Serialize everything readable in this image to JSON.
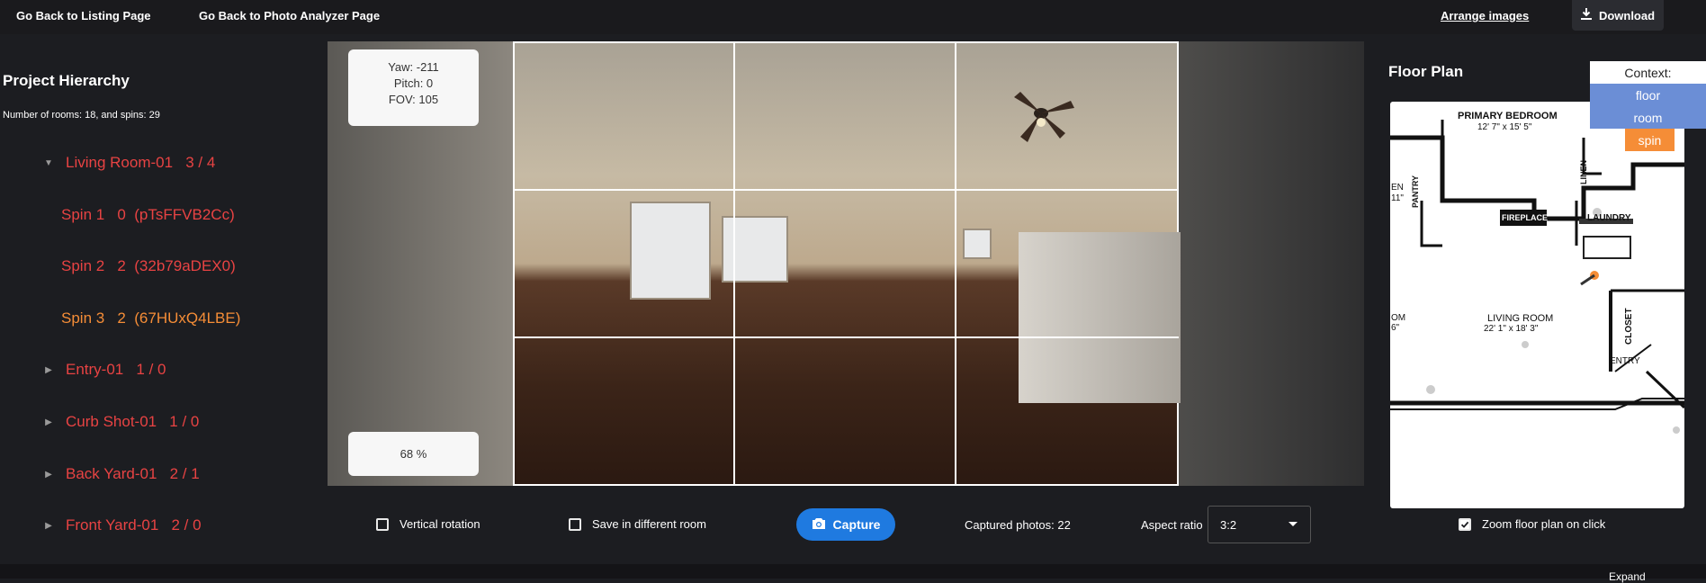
{
  "topbar": {
    "back_listing": "Go Back to Listing Page",
    "back_analyzer": "Go Back to Photo Analyzer Page",
    "arrange": "Arrange images",
    "download": "Download"
  },
  "sidebar": {
    "title": "Project Hierarchy",
    "count": "Number of rooms: 18, and spins: 29",
    "rooms": [
      {
        "label": "Living Room-01   3 / 4",
        "expanded": true
      },
      {
        "label": "Entry-01   1 / 0",
        "expanded": false
      },
      {
        "label": "Curb Shot-01   1 / 0",
        "expanded": false
      },
      {
        "label": "Back Yard-01   2 / 1",
        "expanded": false
      },
      {
        "label": "Front Yard-01   2 / 0",
        "expanded": false
      }
    ],
    "spins": [
      {
        "label": "Spin 1   0  (pTsFFVB2Cc)",
        "active": false
      },
      {
        "label": "Spin 2   2  (32b79aDEX0)",
        "active": false
      },
      {
        "label": "Spin 3   2  (67HUxQ4LBE)",
        "active": true
      }
    ]
  },
  "viewer": {
    "yaw": "Yaw: -211",
    "pitch": "Pitch: 0",
    "fov": "FOV: 105",
    "zoom": "68 %"
  },
  "floorplan": {
    "title": "Floor Plan",
    "labels": {
      "primary_bedroom": "PRIMARY BEDROOM",
      "primary_dim": "12' 7\" x 15' 5\"",
      "fireplace": "FIREPLACE",
      "laundry": "LAUNDRY",
      "pantry": "PANTRY",
      "linen": "LINEN",
      "living_room": "LIVING ROOM",
      "living_dim": "22' 1\" x 18' 3\"",
      "closet": "CLOSET",
      "entry": "ENTRY",
      "frag_en": "EN",
      "frag_11": "11\"",
      "frag_om": "OM",
      "frag_6": "6\""
    },
    "zoom_on_click": "Zoom floor plan on click",
    "zoom_checked": true
  },
  "context": {
    "header": "Context:",
    "items": [
      {
        "label": "floor",
        "color": "#6b8ed6"
      },
      {
        "label": "room",
        "color": "#6b8ed6"
      },
      {
        "label": "spin",
        "color": "#f58d37"
      }
    ]
  },
  "controls": {
    "vertical_rotation": "Vertical rotation",
    "save_different_room": "Save in different room",
    "capture": "Capture",
    "captured": "Captured photos: 22",
    "aspect_label": "Aspect ratio",
    "aspect_value": "3:2"
  },
  "footer": {
    "expand": "Expand"
  }
}
